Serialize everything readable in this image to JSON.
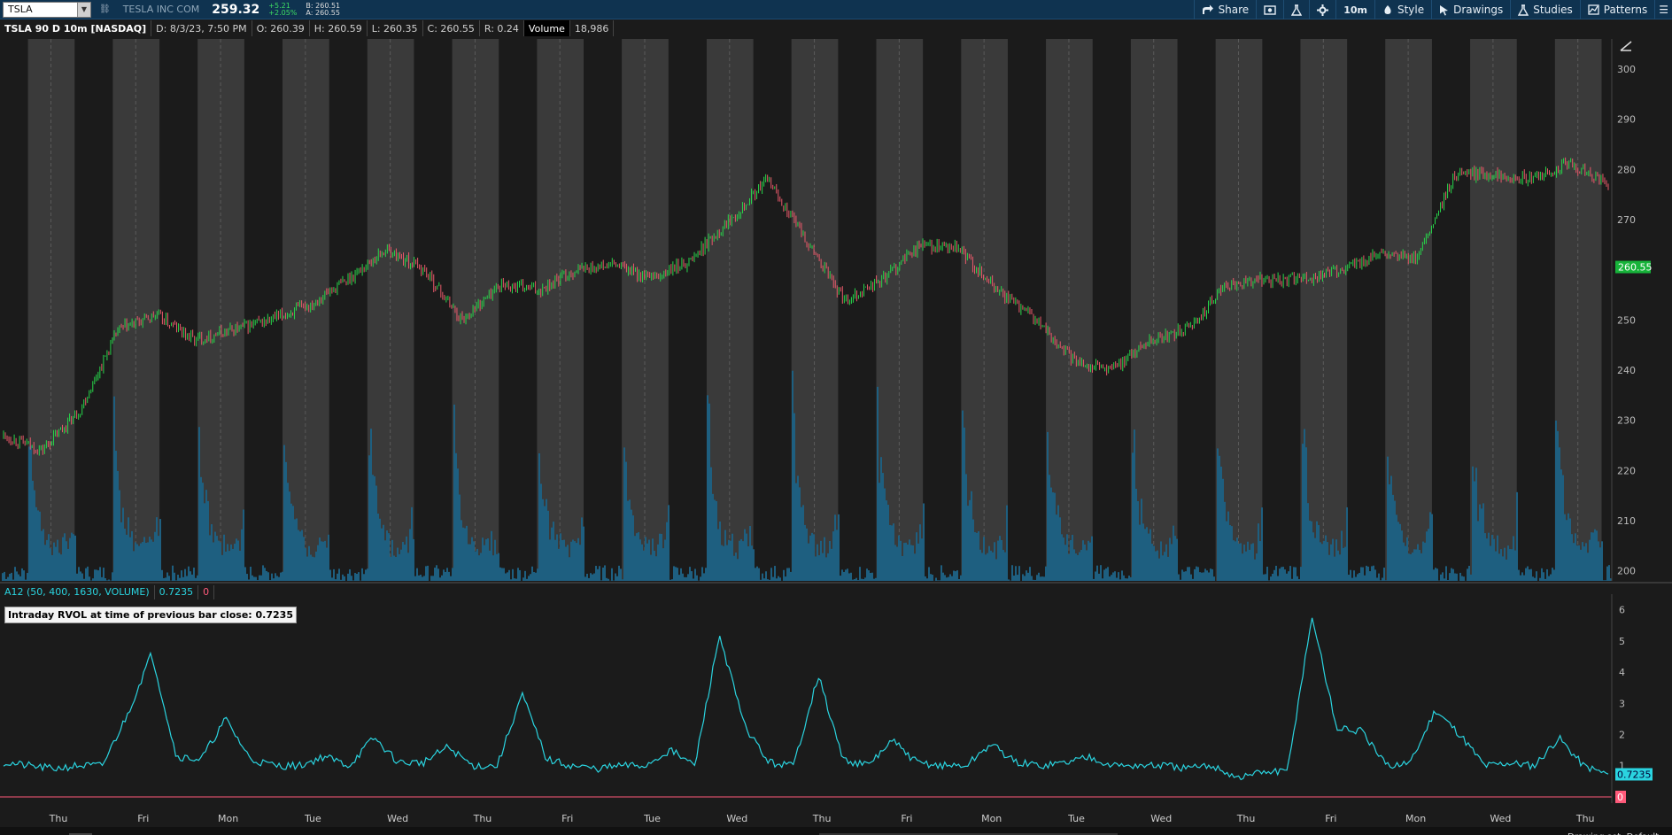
{
  "topbar": {
    "symbol": "TSLA",
    "company": "TESLA INC COM",
    "last": "259.32",
    "net_change": "+5.21",
    "pct_change": "+2.05%",
    "bid": "B: 260.51",
    "ask": "A: 260.55",
    "share_label": "Share",
    "timeframe": "10m",
    "style_label": "Style",
    "drawings_label": "Drawings",
    "studies_label": "Studies",
    "patterns_label": "Patterns"
  },
  "infobar": {
    "title": "TSLA 90 D 10m [NASDAQ]",
    "date": "D: 8/3/23, 7:50 PM",
    "open": "O: 260.39",
    "high": "H: 260.59",
    "low": "L: 260.35",
    "close": "C: 260.55",
    "range": "R: 0.24",
    "volume_label": "Volume",
    "volume_value": "18,986"
  },
  "study": {
    "name": "A12 (50, 400, 1630, VOLUME)",
    "value": "0.7235",
    "zero": "0",
    "bubble": "Intraday RVOL at time of previous bar close: 0.7235"
  },
  "colors": {
    "bg": "#1b1b1b",
    "band_light": "#3a3a3a",
    "up": "#27d64a",
    "down": "#e8596a",
    "volume": "#1e5f80",
    "rvol": "#2ad4e0",
    "price_tag": "#17b33a"
  },
  "footer": {
    "drawing_set": "Drawing set: Default"
  },
  "chart_data": [
    {
      "type": "line",
      "name": "TSLA 10m price (approx. daily closes)",
      "x": [
        "Thu",
        "Fri",
        "Mon",
        "Tue",
        "Wed",
        "Thu",
        "Fri",
        "Mon",
        "Tue",
        "Wed",
        "Thu",
        "Fri",
        "Mon",
        "Tue",
        "Wed",
        "Thu",
        "Fri",
        "Mon",
        "Tue",
        "Wed",
        "Thu",
        "Fri",
        "Mon",
        "Tue",
        "Wed",
        "Thu",
        "Fri",
        "Mon",
        "Tue",
        "Wed",
        "Thu",
        "Fri",
        "Mon",
        "Tue",
        "Wed",
        "Thu",
        "Fri",
        "Mon",
        "Wed",
        "Thu"
      ],
      "y_points": [
        227,
        224,
        232,
        248,
        251,
        246,
        248,
        250,
        253,
        258,
        264,
        260,
        250,
        257,
        256,
        260,
        261,
        258,
        262,
        270,
        278,
        266,
        254,
        258,
        265,
        264,
        256,
        250,
        242,
        240,
        246,
        248,
        257,
        258,
        258,
        260,
        263,
        262,
        279,
        279,
        278,
        281,
        277
      ],
      "ylim": [
        198,
        306
      ],
      "yticks": [
        200,
        210,
        220,
        230,
        240,
        250,
        260,
        270,
        280,
        290,
        300
      ],
      "last_price_tag": "260.55"
    },
    {
      "type": "line",
      "name": "A12 RVOL",
      "y_points": [
        1.1,
        1.0,
        0.9,
        1.0,
        1.0,
        2.6,
        4.6,
        1.3,
        1.2,
        2.5,
        1.2,
        1.0,
        1.0,
        1.3,
        1.0,
        1.9,
        1.1,
        1.1,
        1.6,
        1.0,
        1.0,
        3.3,
        1.2,
        1.0,
        0.9,
        1.0,
        1.0,
        1.5,
        1.0,
        5.2,
        2.3,
        1.1,
        1.0,
        3.9,
        1.2,
        1.0,
        1.8,
        1.1,
        1.0,
        1.0,
        1.7,
        1.1,
        1.0,
        1.1,
        1.3,
        1.0,
        1.0,
        1.0,
        0.9,
        1.0,
        0.6,
        0.8,
        0.8,
        5.8,
        2.2,
        2.1,
        1.0,
        1.1,
        2.8,
        2.0,
        1.0,
        1.1,
        1.0,
        1.9,
        1.0,
        0.7235
      ],
      "ylim": [
        -0.2,
        6.5
      ],
      "yticks": [
        1,
        2,
        3,
        4,
        5,
        6
      ],
      "last_value_tag": "0.7235",
      "zero_tag": "0"
    }
  ],
  "time_axis": {
    "labels": [
      "Thu",
      "Fri",
      "Mon",
      "Tue",
      "Wed",
      "Thu",
      "Fri",
      "Tue",
      "Wed",
      "Thu",
      "Fri",
      "Mon",
      "Tue",
      "Wed",
      "Thu",
      "Fri",
      "Mon",
      "Wed",
      "Thu"
    ]
  }
}
